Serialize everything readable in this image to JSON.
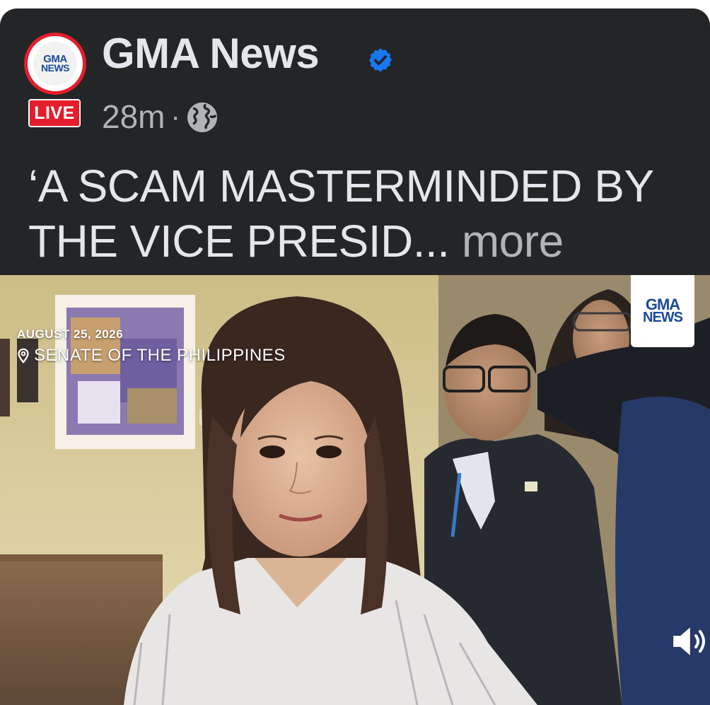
{
  "post": {
    "page_name": "GMA News",
    "avatar_logo": {
      "line1": "GMA",
      "line2": "NEWS"
    },
    "live_badge": "LIVE",
    "timestamp": "28m",
    "separator": "·",
    "caption": "‘A SCAM MASTERMINDED BY THE VICE PRESID...",
    "more_label": "more"
  },
  "video": {
    "date_overlay": "AUGUST 25, 2026",
    "location_overlay": "SENATE OF THE PHILIPPINES",
    "watermark": {
      "line1": "GMA",
      "line2": "NEWS"
    }
  },
  "colors": {
    "card_bg": "#242526",
    "live_red": "#e41e2c",
    "verified_blue": "#1877f2",
    "brand_blue": "#1a4a9c"
  },
  "icons": {
    "verified": "verified-badge-icon",
    "audience": "globe-icon",
    "location": "location-pin-icon",
    "sound": "speaker-muted-icon"
  }
}
